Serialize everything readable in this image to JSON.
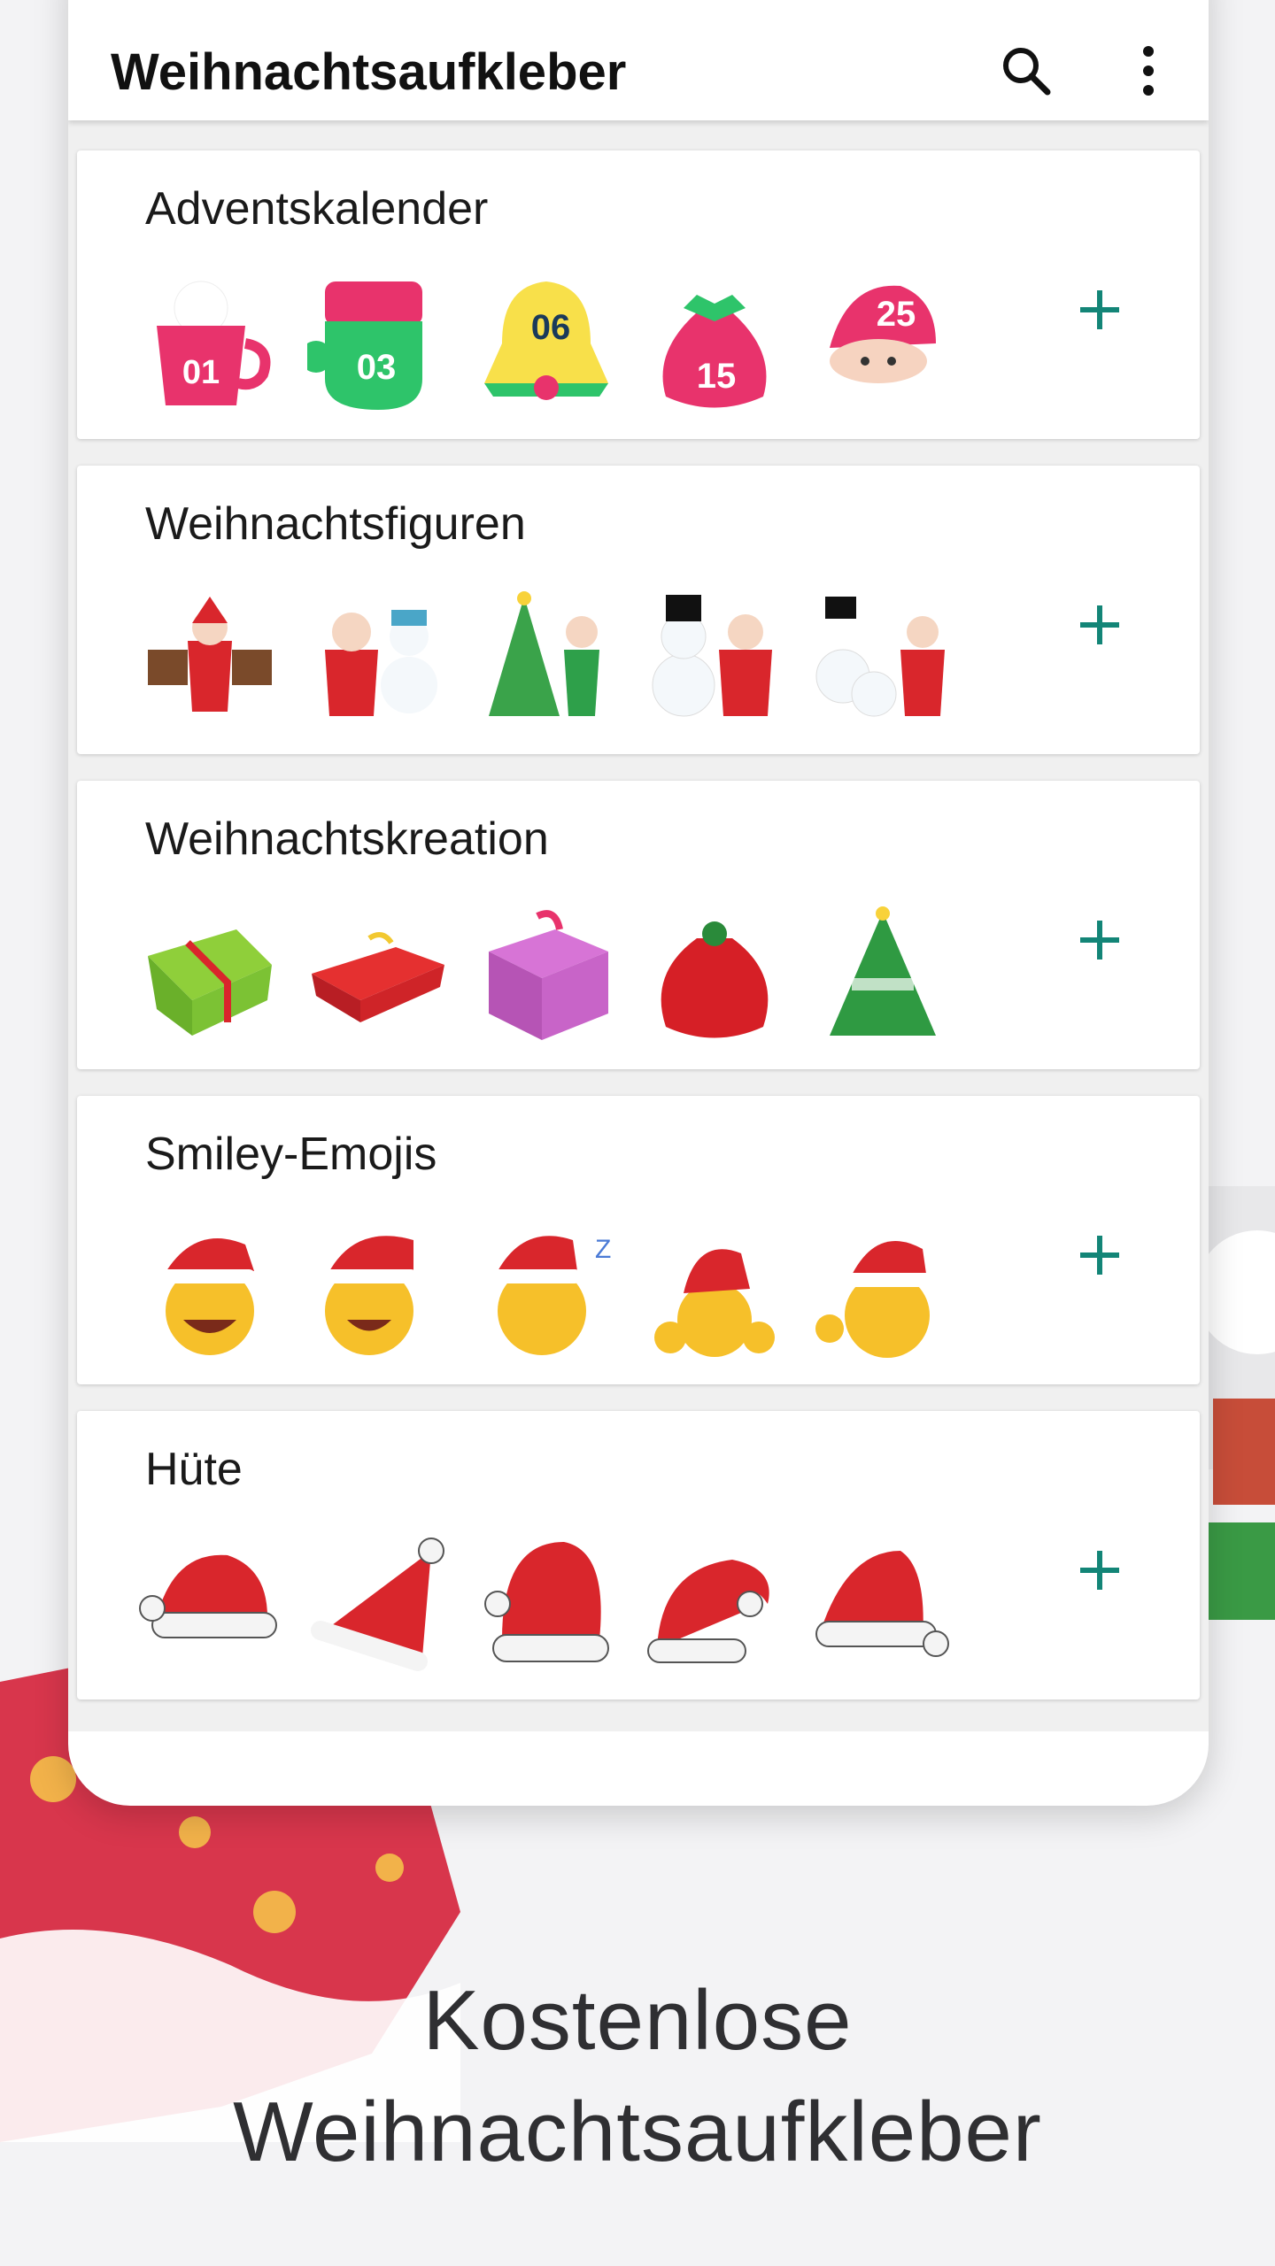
{
  "app": {
    "title": "Weihnachtsaufkleber"
  },
  "toolbar": {
    "search_icon": "search-icon",
    "menu_icon": "more-vert-icon"
  },
  "accent_color": "#138577",
  "packs": [
    {
      "name": "Adventskalender",
      "stickers": [
        "01",
        "03",
        "06",
        "15",
        "25"
      ]
    },
    {
      "name": "Weihnachtsfiguren",
      "stickers": []
    },
    {
      "name": "Weihnachtskreation",
      "stickers": []
    },
    {
      "name": "Smiley-Emojis",
      "stickers": []
    },
    {
      "name": "Hüte",
      "stickers": []
    }
  ],
  "footer": {
    "line1": "Kostenlose",
    "line2": "Weihnachtsaufkleber"
  }
}
